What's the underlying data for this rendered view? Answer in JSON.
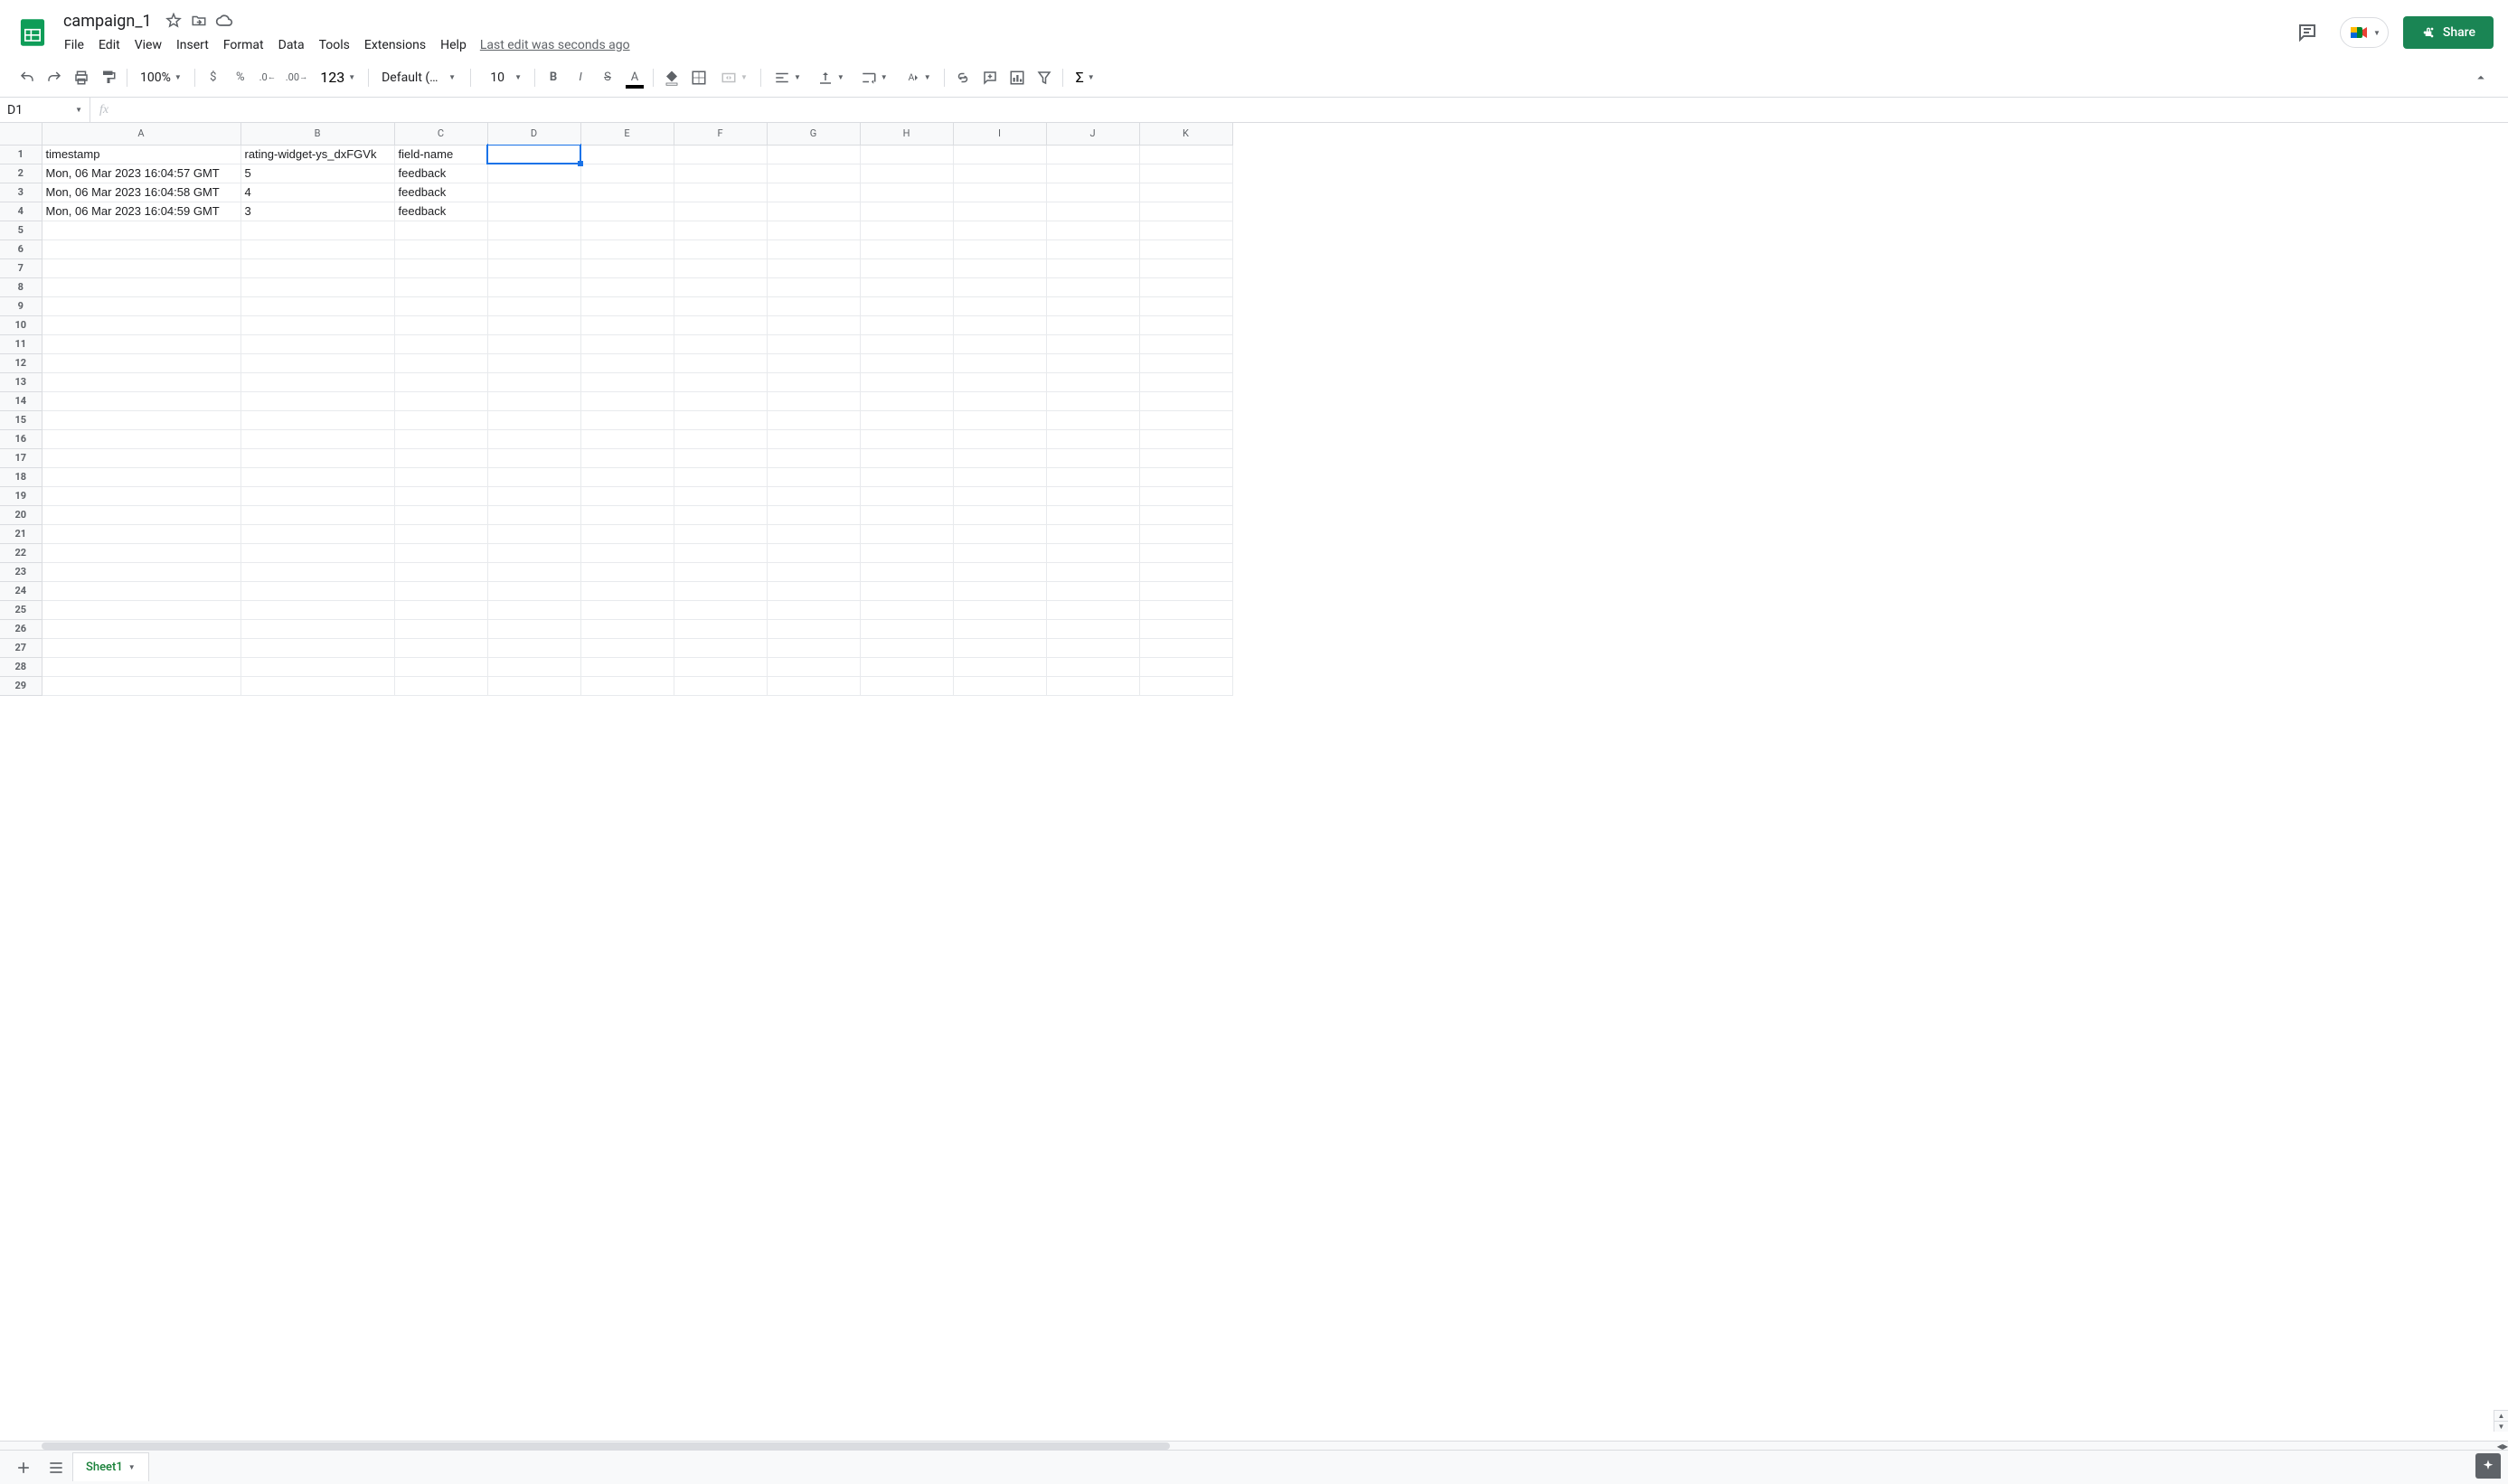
{
  "header": {
    "doc_title": "campaign_1",
    "menus": [
      "File",
      "Edit",
      "View",
      "Insert",
      "Format",
      "Data",
      "Tools",
      "Extensions",
      "Help"
    ],
    "last_edit": "Last edit was seconds ago",
    "share_label": "Share"
  },
  "toolbar": {
    "zoom": "100%",
    "number_format": "123",
    "font_name": "Default (Ari...",
    "font_size": "10"
  },
  "name_box": "D1",
  "formula": "",
  "grid": {
    "columns": [
      "A",
      "B",
      "C",
      "D",
      "E",
      "F",
      "G",
      "H",
      "I",
      "J",
      "K"
    ],
    "col_classes": [
      "col-A",
      "col-B",
      "col-C",
      "col-D",
      "col-default",
      "col-default",
      "col-default",
      "col-default",
      "col-default",
      "col-default",
      "col-default"
    ],
    "row_count": 29,
    "selected_cell": "D1",
    "data": [
      [
        "timestamp",
        "rating-widget-ys_dxFGVk",
        "field-name",
        "",
        "",
        "",
        "",
        "",
        "",
        "",
        ""
      ],
      [
        "Mon, 06 Mar 2023 16:04:57 GMT",
        "5",
        "feedback",
        "",
        "",
        "",
        "",
        "",
        "",
        "",
        ""
      ],
      [
        "Mon, 06 Mar 2023 16:04:58 GMT",
        "4",
        "feedback",
        "",
        "",
        "",
        "",
        "",
        "",
        "",
        ""
      ],
      [
        "Mon, 06 Mar 2023 16:04:59 GMT",
        "3",
        "feedback",
        "",
        "",
        "",
        "",
        "",
        "",
        "",
        ""
      ]
    ]
  },
  "sheet_tabs": {
    "active": "Sheet1"
  }
}
